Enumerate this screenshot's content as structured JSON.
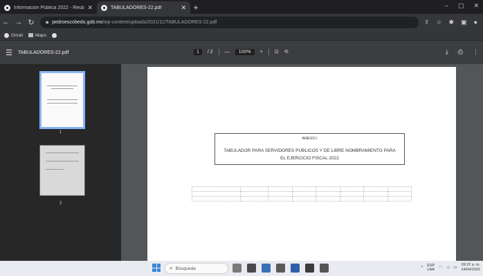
{
  "browser": {
    "tabs": [
      {
        "title": "Información Pública 2022 - Reub",
        "active": false
      },
      {
        "title": "TABULADORES-22.pdf",
        "active": true
      }
    ],
    "url_prefix": "",
    "url_domain": "pedroescobedo.gob.mx",
    "url_path": "/wp-content/uploads/2021/11/TABULADORES-22.pdf",
    "bookmarks": [
      {
        "label": "Gmail",
        "icon": "gmail-icon"
      },
      {
        "label": "Maps",
        "icon": "maps-icon"
      }
    ]
  },
  "pdf_viewer": {
    "doc_title": "TABULADORES-22.pdf",
    "current_page": "1",
    "page_total": "/ 2",
    "zoom": "100%",
    "thumbnails": [
      {
        "number": "1",
        "selected": true
      },
      {
        "number": "2",
        "selected": false
      }
    ]
  },
  "document": {
    "annex": "ANEXO I",
    "table_title": "TABULADOR PARA SERVIDORES PÚBLICOS Y DE LIBRE NOMBRAMIENTO PARA EL EJERCICIO FISCAL 2022"
  },
  "taskbar": {
    "search_label": "Búsqueda",
    "lang_line1": "ESP",
    "lang_line2": "LAA",
    "time": "09:22 a. m.",
    "date": "14/04/2022"
  },
  "colors": {
    "tab_strip": "#1f1f23",
    "toolbar": "#35363a",
    "pdf_header": "#3c3d41",
    "sidebar": "#272727",
    "doc_background": "#525659",
    "thumbnail_selected": "#8ab4f8",
    "taskbar": "#e9ebf0"
  }
}
